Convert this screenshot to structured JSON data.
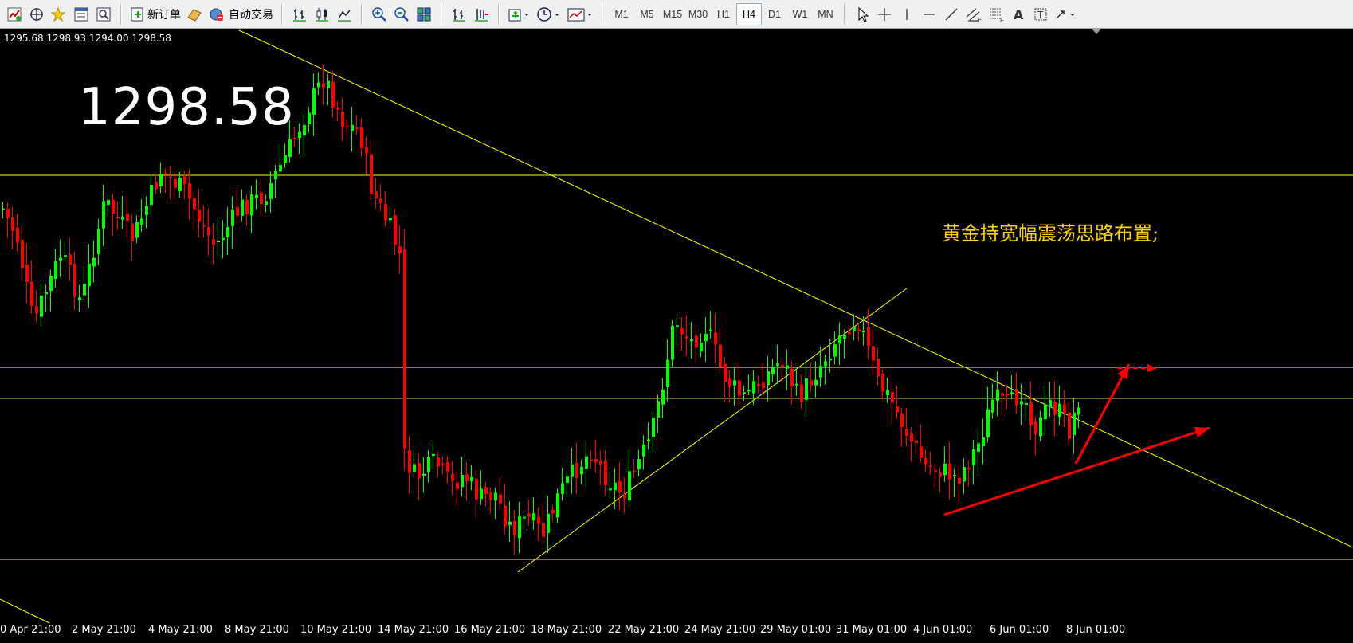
{
  "toolbar": {
    "new_order_label": "新订单",
    "auto_trade_label": "自动交易",
    "timeframes": [
      "M1",
      "M5",
      "M15",
      "M30",
      "H1",
      "H4",
      "D1",
      "W1",
      "MN"
    ],
    "active_timeframe": "H4",
    "icons": [
      "new-chart-icon",
      "navigator-icon",
      "favorites-icon",
      "market-watch-icon",
      "data-window-icon",
      "new-order-icon",
      "expert-icon",
      "auto-trade-icon",
      "bar-chart-icon",
      "candlestick-icon",
      "line-chart-icon",
      "zoom-in-icon",
      "zoom-out-icon",
      "tile-windows-icon",
      "scroll-chart-icon",
      "chart-shift-icon",
      "indicators-icon",
      "periods-icon",
      "templates-icon",
      "cursor-icon",
      "crosshair-icon",
      "vertical-line-icon",
      "horizontal-line-icon",
      "trendline-icon",
      "equidistant-channel-icon",
      "fibonacci-icon",
      "text-icon",
      "text-label-icon",
      "arrows-icon"
    ]
  },
  "chart": {
    "ohlc_text": "1295.68 1298.93 1294.00 1298.58",
    "big_price": "1298.58",
    "annotation": "黄金持宽幅震荡思路布置;",
    "x_labels": [
      "0 Apr 21:00",
      "2 May 21:00",
      "4 May 21:00",
      "8 May 21:00",
      "10 May 21:00",
      "14 May 21:00",
      "16 May 21:00",
      "18 May 21:00",
      "22 May 21:00",
      "24 May 21:00",
      "29 May 01:00",
      "31 May 01:00",
      "4 Jun 01:00",
      "6 Jun 01:00",
      "8 Jun 01:00"
    ],
    "colors": {
      "background": "#000000",
      "bull": "#00ff00",
      "bear": "#ff0000",
      "lines": "#ffff00",
      "arrows": "#ff0000",
      "text": "#ffffff"
    }
  }
}
